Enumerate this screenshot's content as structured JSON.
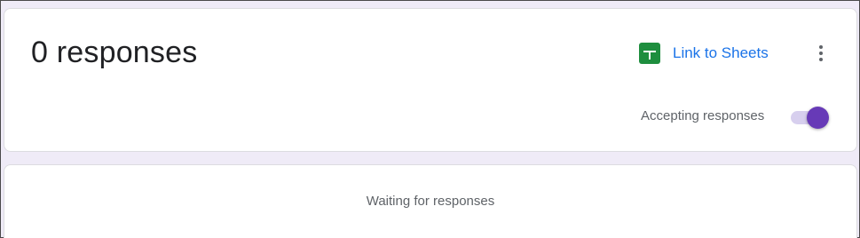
{
  "summary": {
    "title": "0 responses",
    "link_label": "Link to Sheets",
    "link_icon": "google-sheets-icon",
    "more_icon": "more-vert-icon",
    "accepting_label": "Accepting responses",
    "accepting_enabled": true
  },
  "responses": {
    "waiting_text": "Waiting for responses"
  },
  "colors": {
    "accent": "#1a73e8",
    "sheets_green": "#1e8e3e",
    "toggle_on": "#673ab7",
    "page_bg": "#efebf7"
  }
}
